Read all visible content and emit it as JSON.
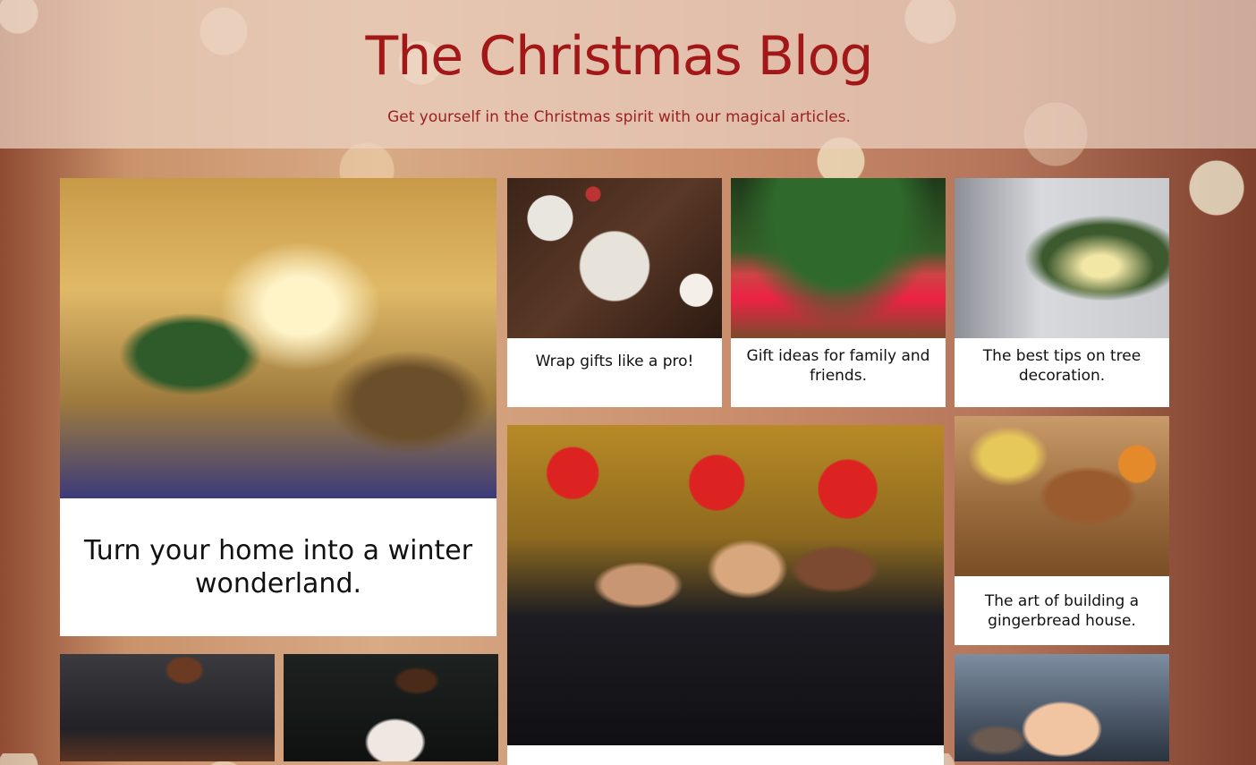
{
  "header": {
    "title": "The Christmas Blog",
    "tagline": "Get yourself in the Christmas spirit with our magical articles."
  },
  "articles": [
    {
      "id": "winter-wonderland",
      "caption": "Turn your home into a winter wonderland.",
      "image": "decorated-living-room-photo"
    },
    {
      "id": "wrap-gifts",
      "caption": "Wrap gifts like a pro!",
      "image": "wrapped-gift-photo"
    },
    {
      "id": "gift-ideas",
      "caption": "Gift ideas for family and friends.",
      "image": "presents-under-tree-photo"
    },
    {
      "id": "tree-decoration",
      "caption": "The best tips on tree decoration.",
      "image": "decorating-tree-photo"
    },
    {
      "id": "party",
      "caption": "",
      "image": "christmas-party-photo"
    },
    {
      "id": "gingerbread",
      "caption": "The art of building a gingerbread house.",
      "image": "gingerbread-house-photo"
    },
    {
      "id": "home-alone",
      "caption": "",
      "image": "movie-kid-photo"
    },
    {
      "id": "chocolate-1",
      "caption": "",
      "image": "chocolate-drip-photo"
    },
    {
      "id": "chocolate-2",
      "caption": "",
      "image": "chocolate-spoon-photo"
    }
  ]
}
